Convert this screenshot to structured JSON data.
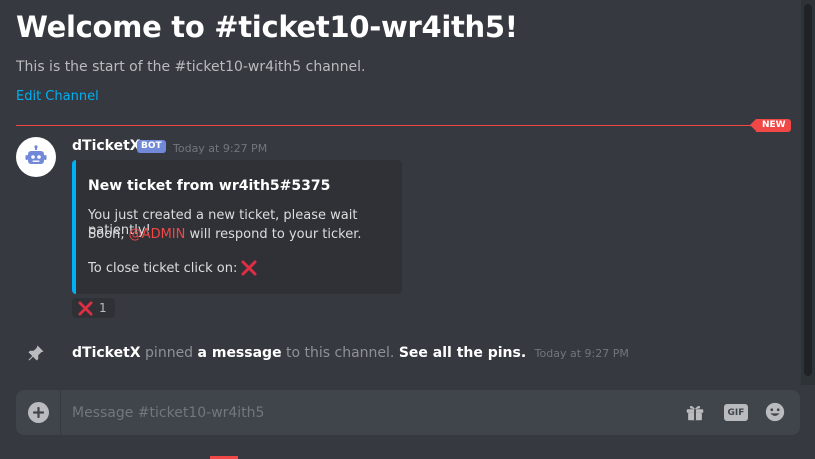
{
  "channel": {
    "title": "Welcome to #ticket10-wr4ith5!",
    "description": "This is the start of the #ticket10-wr4ith5 channel.",
    "edit_label": "Edit Channel"
  },
  "divider": {
    "badge": "NEW"
  },
  "message": {
    "username": "dTicketX",
    "bot_tag": "BOT",
    "timestamp": "Today at 9:27 PM",
    "embed": {
      "title": "New ticket from wr4ith5#5375",
      "line1": "You just created a new ticket, please wait patiently!",
      "line2_prefix": "Soon,",
      "mention": "@ADMIN",
      "line2_suffix": "will respond to your ticker.",
      "line3": "To close ticket click on:"
    },
    "reaction": {
      "emoji": "cross-mark-icon",
      "count": "1"
    }
  },
  "system": {
    "username": "dTicketX",
    "pinned_text": "pinned",
    "message_link": "a message",
    "to_channel": "to this channel.",
    "see_pins": "See all the pins.",
    "timestamp": "Today at 9:27 PM"
  },
  "composer": {
    "placeholder": "Message #ticket10-wr4ith5",
    "gif_label": "GIF"
  },
  "colors": {
    "background": "#36393f",
    "accent_link": "#00b0f4",
    "new_divider": "#f04747",
    "bot_tag": "#7289da",
    "mention": "#f04747"
  }
}
